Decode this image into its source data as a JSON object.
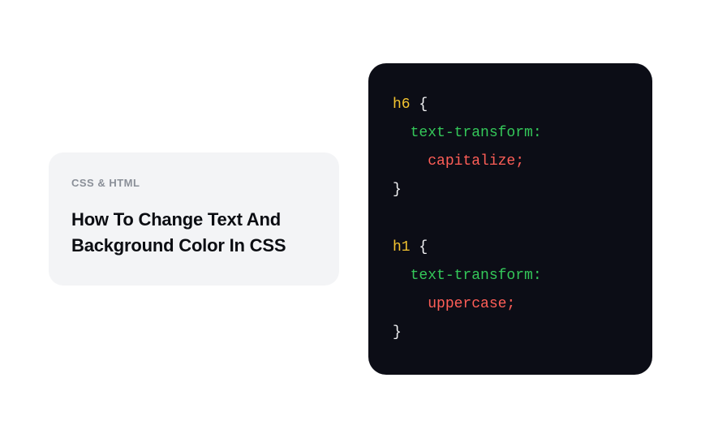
{
  "article": {
    "category": "CSS & HTML",
    "title": "How To Change Text And Background Color In CSS"
  },
  "code": {
    "rule1": {
      "selector": "h6",
      "brace_open": " {",
      "prop": "text-transform:",
      "value": "capitalize;",
      "brace_close": "}"
    },
    "rule2": {
      "selector": "h1",
      "brace_open": " {",
      "prop": "text-transform:",
      "value": "uppercase;",
      "brace_close": "}"
    },
    "indent1": "  ",
    "indent2": "    "
  }
}
